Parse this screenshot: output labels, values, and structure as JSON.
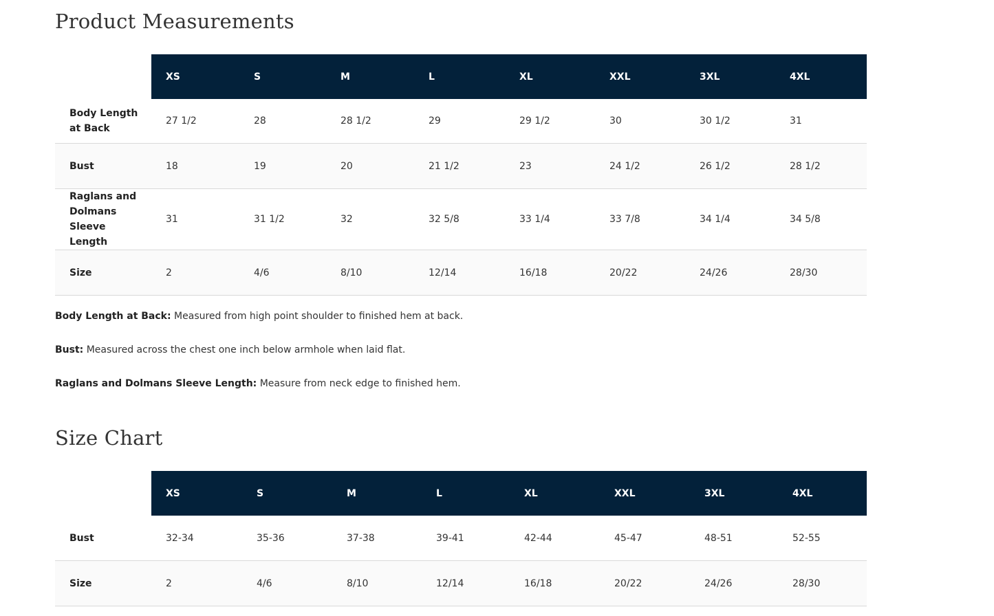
{
  "measurements": {
    "title": "Product Measurements",
    "sizes": [
      "XS",
      "S",
      "M",
      "L",
      "XL",
      "XXL",
      "3XL",
      "4XL"
    ],
    "rows": [
      {
        "label": "Body Length at Back",
        "values": [
          "27 1/2",
          "28",
          "28 1/2",
          "29",
          "29 1/2",
          "30",
          "30 1/2",
          "31"
        ]
      },
      {
        "label": "Bust",
        "values": [
          "18",
          "19",
          "20",
          "21 1/2",
          "23",
          "24 1/2",
          "26 1/2",
          "28 1/2"
        ]
      },
      {
        "label": "Raglans and Dolmans Sleeve Length",
        "values": [
          "31",
          "31 1/2",
          "32",
          "32 5/8",
          "33 1/4",
          "33 7/8",
          "34 1/4",
          "34 5/8"
        ]
      },
      {
        "label": "Size",
        "values": [
          "2",
          "4/6",
          "8/10",
          "12/14",
          "16/18",
          "20/22",
          "24/26",
          "28/30"
        ]
      }
    ]
  },
  "notes": [
    {
      "term": "Body Length at Back:",
      "text": " Measured from high point shoulder to finished hem at back."
    },
    {
      "term": "Bust:",
      "text": " Measured across the chest one inch below armhole when laid flat."
    },
    {
      "term": "Raglans and Dolmans Sleeve Length:",
      "text": " Measure from neck edge to finished hem."
    }
  ],
  "size_chart": {
    "title": "Size Chart",
    "sizes": [
      "XS",
      "S",
      "M",
      "L",
      "XL",
      "XXL",
      "3XL",
      "4XL"
    ],
    "rows": [
      {
        "label": "Bust",
        "values": [
          "32-34",
          "35-36",
          "37-38",
          "39-41",
          "42-44",
          "45-47",
          "48-51",
          "52-55"
        ]
      },
      {
        "label": "Size",
        "values": [
          "2",
          "4/6",
          "8/10",
          "12/14",
          "16/18",
          "20/22",
          "24/26",
          "28/30"
        ]
      }
    ]
  },
  "colors": {
    "header_bg": "#03213a",
    "header_text": "#ffffff",
    "row_divider": "#d9d9d9"
  }
}
